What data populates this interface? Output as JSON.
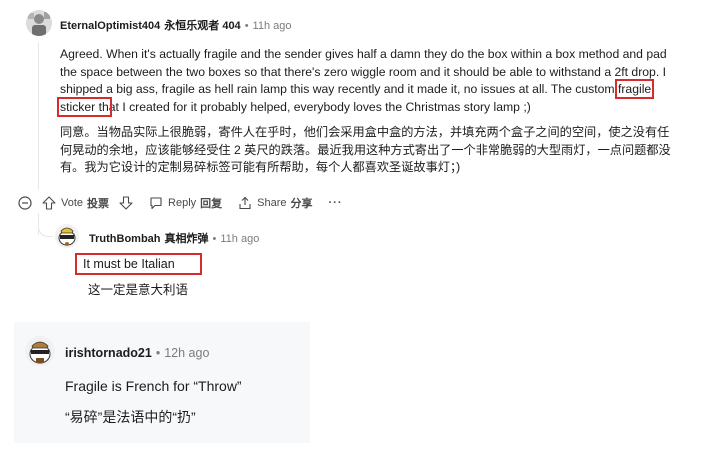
{
  "comment1": {
    "username": "EternalOptimist404",
    "username_cn": "永恒乐观者 404",
    "time": "11h ago",
    "text_en_1": "Agreed. When it's actually fragile and the sender gives half a damn they do the box within a box method and pad the space between the two boxes so that there's zero wiggle room and it should be able to withstand a 2ft drop. I shipped a big ass, fragile as hell rain lamp this way recently and it made it, no issues at all. The custom ",
    "text_en_highlight": "fragile sticker th",
    "text_en_2": "at I created for it probably helped, everybody loves the Christmas story lamp ;)",
    "text_cn": "同意。当物品实际上很脆弱，寄件人在乎时，他们会采用盒中盒的方法，并填充两个盒子之间的空间，使之没有任何晃动的余地，应该能够经受住 2 英尺的跌落。最近我用这种方式寄出了一个非常脆弱的大型雨灯，一点问题都没有。我为它设计的定制易碎标签可能有所帮助，每个人都喜欢圣诞故事灯；)"
  },
  "actions": {
    "vote": "Vote",
    "vote_cn": "投票",
    "reply": "Reply",
    "reply_cn": "回复",
    "share": "Share",
    "share_cn": "分享",
    "more": "···"
  },
  "comment2": {
    "username": "TruthBombah",
    "username_cn": "真相炸弹",
    "time": "11h ago",
    "text_en": "It must be Italian",
    "text_cn": "这一定是意大利语"
  },
  "comment3": {
    "username": "irishtornado21",
    "time": "12h ago",
    "text_en": "Fragile is French for “Throw”",
    "text_cn": "“易碎”是法语中的“扔”"
  },
  "separator": "•"
}
